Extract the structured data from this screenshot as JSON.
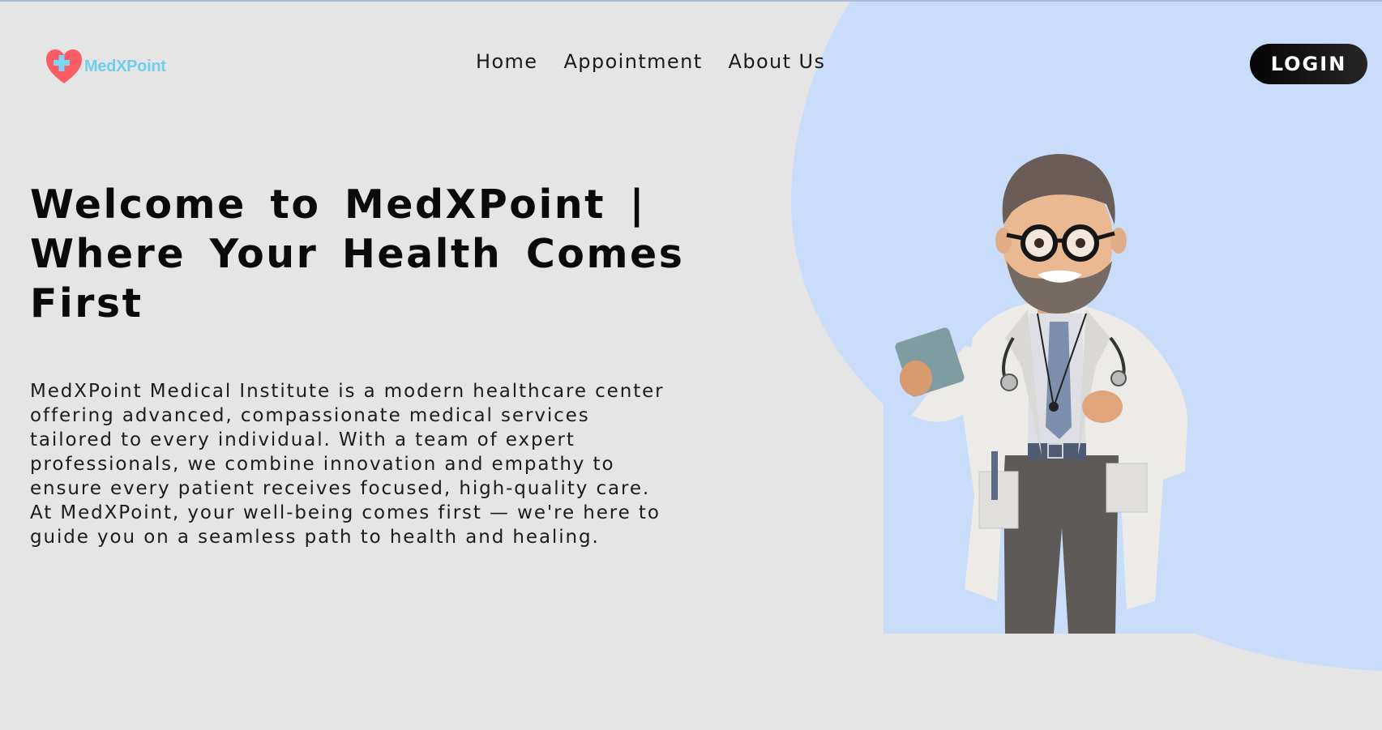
{
  "brand": {
    "name": "MedXPoint",
    "logo_icon": "heart-cross-icon",
    "colors": {
      "heart": "#fc5c65",
      "cross": "#7dd4f5",
      "text": "#6fcdf0"
    }
  },
  "nav": {
    "items": [
      {
        "label": "Home"
      },
      {
        "label": "Appointment"
      },
      {
        "label": "About Us"
      }
    ]
  },
  "header": {
    "login_label": "LOGIN"
  },
  "hero": {
    "title": "Welcome to MedXPoint | Where Your Health Comes First",
    "description": "MedXPoint Medical Institute is a modern healthcare center offering advanced, compassionate medical services tailored to every individual. With a team of expert professionals, we combine innovation and empathy to ensure every patient receives focused, high-quality care. At MedXPoint, your well-being comes first — we're here to guide you on a seamless path to health and healing.",
    "illustration": "doctor-illustration"
  },
  "colors": {
    "background": "#e5e5e5",
    "accent_blob": "#c9dcfa",
    "button": "#111111"
  }
}
